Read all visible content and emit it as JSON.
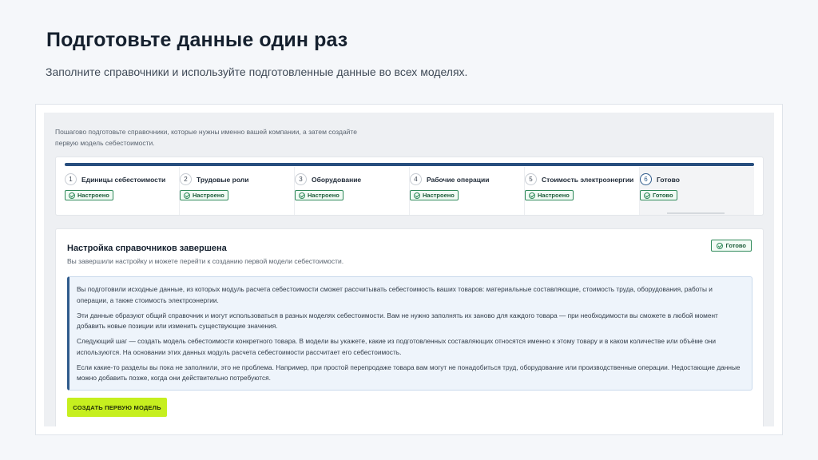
{
  "slide": {
    "title": "Подготовьте данные один раз",
    "subtitle": "Заполните справочники и используйте подготовленные данные во всех моделях."
  },
  "app": {
    "intro": "Пошагово подготовьте справочники, которые нужны именно вашей компании, а затем создайте первую модель себестоимости.",
    "steps": [
      {
        "num": "1",
        "label": "Единицы себестоимости",
        "status": "Настроено"
      },
      {
        "num": "2",
        "label": "Трудовые роли",
        "status": "Настроено"
      },
      {
        "num": "3",
        "label": "Оборудование",
        "status": "Настроено"
      },
      {
        "num": "4",
        "label": "Рабочие операции",
        "status": "Настроено"
      },
      {
        "num": "5",
        "label": "Стоимость электроэнергии",
        "status": "Настроено"
      },
      {
        "num": "6",
        "label": "Готово",
        "status": "Готово"
      }
    ],
    "done": {
      "title": "Настройка справочников завершена",
      "subtitle": "Вы завершили настройку и можете перейти к созданию первой модели себестоимости.",
      "badge": "Готово",
      "paragraphs": [
        "Вы подготовили исходные данные, из которых модуль расчета себестоимости сможет рассчитывать себестоимость ваших товаров: материальные составляющие, стоимость труда, оборудования, работы и операции, а также стоимость электроэнергии.",
        "Эти данные образуют общий справочник и могут использоваться в разных моделях себестоимости. Вам не нужно заполнять их заново для каждого товара — при необходимости вы сможете в любой момент добавить новые позиции или изменить существующие значения.",
        "Следующий шаг — создать модель себестоимости конкретного товара. В модели вы укажете, какие из подготовленных составляющих относятся именно к этому товару и в каком количестве или объёме они используются. На основании этих данных модуль расчета себестоимости рассчитает его себестоимость.",
        "Если какие-то разделы вы пока не заполнили, это не проблема. Например, при простой перепродаже товара вам могут не понадобиться труд, оборудование или производственные операции. Недостающие данные можно добавить позже, когда они действительно потребуются."
      ],
      "cta_label": "СОЗДАТЬ ПЕРВУЮ МОДЕЛЬ"
    }
  },
  "colors": {
    "accent": "#274e7e",
    "success": "#2f8a5a",
    "cta": "#c6ef1f"
  }
}
